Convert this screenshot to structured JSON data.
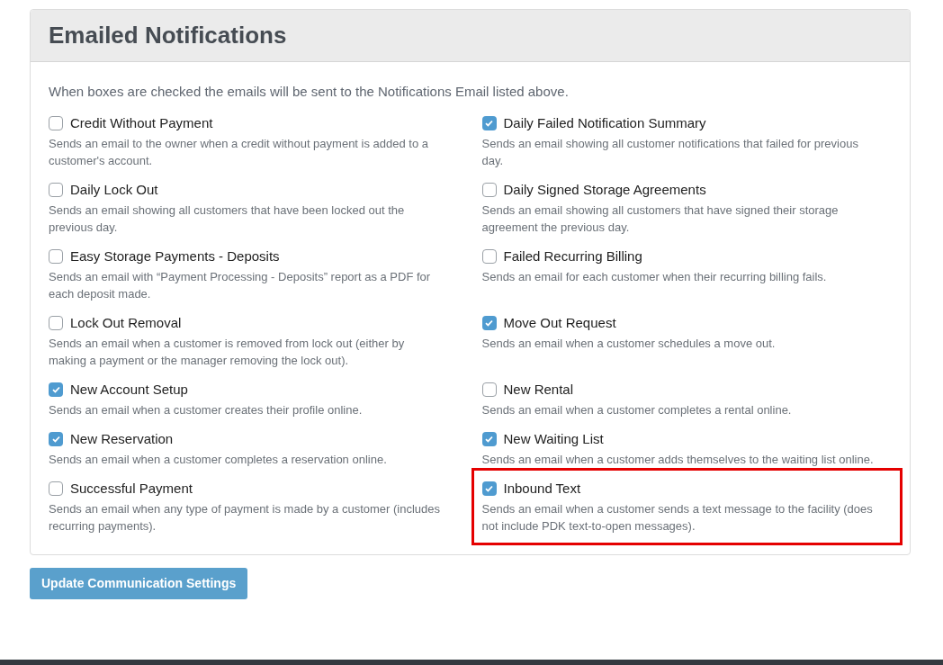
{
  "panel": {
    "title": "Emailed Notifications",
    "intro": "When boxes are checked the emails will be sent to the Notifications Email listed above.",
    "items": [
      {
        "label": "Credit Without Payment",
        "description": "Sends an email to the owner when a credit without payment is added to a customer's account.",
        "checked": false,
        "highlighted": false
      },
      {
        "label": "Daily Failed Notification Summary",
        "description": "Sends an email showing all customer notifications that failed for previous day.",
        "checked": true,
        "highlighted": false
      },
      {
        "label": "Daily Lock Out",
        "description": "Sends an email showing all customers that have been locked out the previous day.",
        "checked": false,
        "highlighted": false
      },
      {
        "label": "Daily Signed Storage Agreements",
        "description": "Sends an email showing all customers that have signed their storage agreement the previous day.",
        "checked": false,
        "highlighted": false
      },
      {
        "label": "Easy Storage Payments - Deposits",
        "description": "Sends an email with “Payment Processing - Deposits” report as a PDF for each deposit made.",
        "checked": false,
        "highlighted": false
      },
      {
        "label": "Failed Recurring Billing",
        "description": "Sends an email for each customer when their recurring billing fails.",
        "checked": false,
        "highlighted": false
      },
      {
        "label": "Lock Out Removal",
        "description": "Sends an email when a customer is removed from lock out (either by making a payment or the manager removing the lock out).",
        "checked": false,
        "highlighted": false
      },
      {
        "label": "Move Out Request",
        "description": "Sends an email when a customer schedules a move out.",
        "checked": true,
        "highlighted": false
      },
      {
        "label": "New Account Setup",
        "description": "Sends an email when a customer creates their profile online.",
        "checked": true,
        "highlighted": false
      },
      {
        "label": "New Rental",
        "description": "Sends an email when a customer completes a rental online.",
        "checked": false,
        "highlighted": false
      },
      {
        "label": "New Reservation",
        "description": "Sends an email when a customer completes a reservation online.",
        "checked": true,
        "highlighted": false
      },
      {
        "label": "New Waiting List",
        "description": "Sends an email when a customer adds themselves to the waiting list online.",
        "checked": true,
        "highlighted": false
      },
      {
        "label": "Successful Payment",
        "description": "Sends an email when any type of payment is made by a customer (includes recurring payments).",
        "checked": false,
        "highlighted": false
      },
      {
        "label": "Inbound Text",
        "description": "Sends an email when a customer sends a text message to the facility (does not include PDK text-to-open messages).",
        "checked": true,
        "highlighted": true
      }
    ]
  },
  "submit_button": "Update Communication Settings"
}
